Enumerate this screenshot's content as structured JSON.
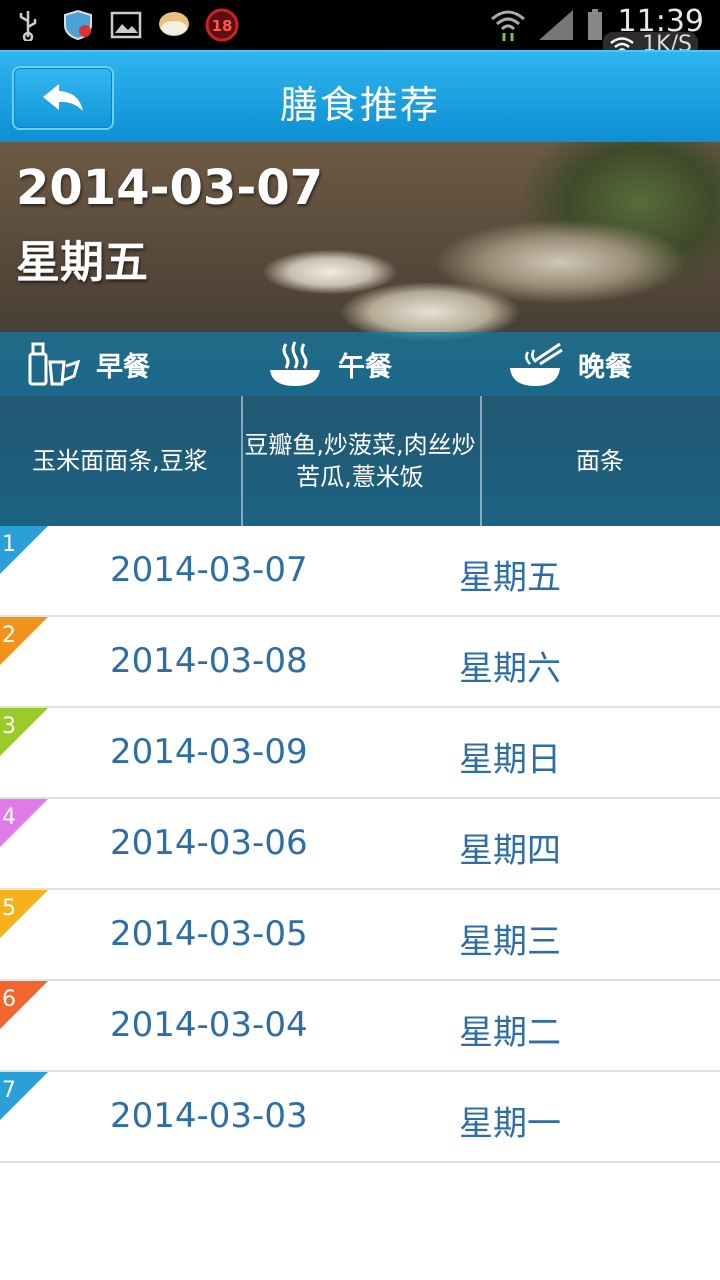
{
  "statusbar": {
    "time": "11:39",
    "speed": "1K/S",
    "icons": [
      "usb-icon",
      "security-icon",
      "gallery-icon",
      "app-icon",
      "age-18-icon",
      "wifi-signal-icon",
      "cell-signal-icon",
      "battery-icon"
    ],
    "age_badge": "18"
  },
  "titlebar": {
    "title": "膳食推荐",
    "back_icon": "back-arrow-icon"
  },
  "hero": {
    "date": "2014-03-07",
    "weekday": "星期五",
    "meals": [
      {
        "label": "早餐",
        "icon": "breakfast-icon",
        "food": "玉米面面条,豆浆"
      },
      {
        "label": "午餐",
        "icon": "lunch-bowl-icon",
        "food": "豆瓣鱼,炒菠菜,肉丝炒苦瓜,薏米饭"
      },
      {
        "label": "晚餐",
        "icon": "dinner-noodle-icon",
        "food": "面条"
      }
    ]
  },
  "list": [
    {
      "num": "1",
      "date": "2014-03-07",
      "weekday": "星期五",
      "color": "#2b9fd8"
    },
    {
      "num": "2",
      "date": "2014-03-08",
      "weekday": "星期六",
      "color": "#f2931c"
    },
    {
      "num": "3",
      "date": "2014-03-09",
      "weekday": "星期日",
      "color": "#9acb2a"
    },
    {
      "num": "4",
      "date": "2014-03-06",
      "weekday": "星期四",
      "color": "#e07ae8"
    },
    {
      "num": "5",
      "date": "2014-03-05",
      "weekday": "星期三",
      "color": "#f6b21b"
    },
    {
      "num": "6",
      "date": "2014-03-04",
      "weekday": "星期二",
      "color": "#f2662d"
    },
    {
      "num": "7",
      "date": "2014-03-03",
      "weekday": "星期一",
      "color": "#2b9fd8"
    }
  ],
  "colors": {
    "titlebar": "#1aa1df",
    "list_text": "#2e6ea8"
  }
}
